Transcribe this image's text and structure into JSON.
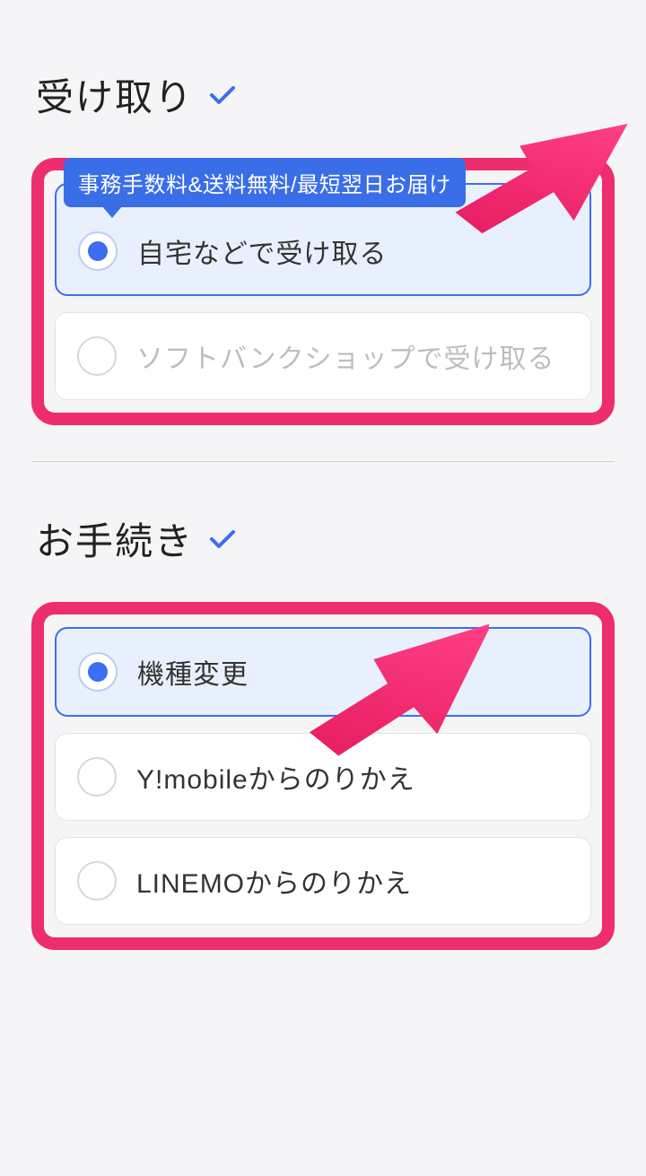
{
  "sections": {
    "delivery": {
      "title": "受け取り",
      "badge": "事務手数料&送料無料/最短翌日お届け",
      "options": [
        {
          "label": "自宅などで受け取る",
          "selected": true
        },
        {
          "label": "ソフトバンクショップで受け取る",
          "selected": false
        }
      ]
    },
    "procedure": {
      "title": "お手続き",
      "options": [
        {
          "label": "機種変更",
          "selected": true
        },
        {
          "label": "Y!mobileからのりかえ",
          "selected": false
        },
        {
          "label": "LINEMOからのりかえ",
          "selected": false
        }
      ]
    }
  },
  "colors": {
    "accent": "#3d6df0",
    "highlight": "#ed2d6e"
  }
}
